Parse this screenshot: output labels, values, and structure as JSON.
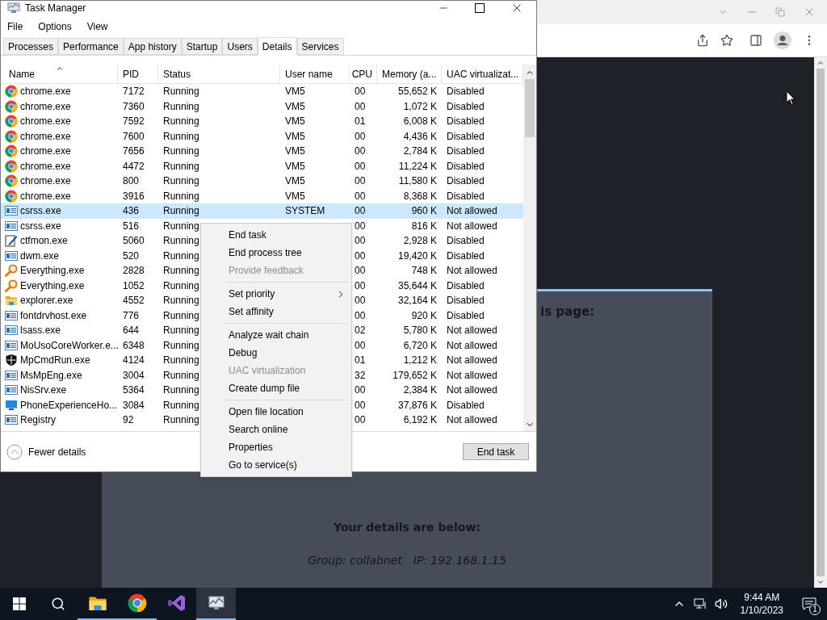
{
  "browser": {
    "page": {
      "heading_fragment": "is page:",
      "details_title": "Your details are below:",
      "group": "Group: collabnet",
      "ip": "IP: 192.168.1.15"
    }
  },
  "task_manager": {
    "title": "Task Manager",
    "menu": [
      "File",
      "Options",
      "View"
    ],
    "tabs": [
      {
        "label": "Processes",
        "selected": false
      },
      {
        "label": "Performance",
        "selected": false
      },
      {
        "label": "App history",
        "selected": false
      },
      {
        "label": "Startup",
        "selected": false
      },
      {
        "label": "Users",
        "selected": false
      },
      {
        "label": "Details",
        "selected": true
      },
      {
        "label": "Services",
        "selected": false
      }
    ],
    "columns": [
      "Name",
      "PID",
      "Status",
      "User name",
      "CPU",
      "Memory (a...",
      "UAC virtualizat..."
    ],
    "rows": [
      {
        "kind": "chrome",
        "name": "chrome.exe",
        "pid": "7172",
        "status": "Running",
        "user": "VM5",
        "cpu": "00",
        "memory": "55,652 K",
        "uac": "Disabled",
        "selected": false
      },
      {
        "kind": "chrome",
        "name": "chrome.exe",
        "pid": "7360",
        "status": "Running",
        "user": "VM5",
        "cpu": "00",
        "memory": "1,072 K",
        "uac": "Disabled",
        "selected": false
      },
      {
        "kind": "chrome",
        "name": "chrome.exe",
        "pid": "7592",
        "status": "Running",
        "user": "VM5",
        "cpu": "01",
        "memory": "6,008 K",
        "uac": "Disabled",
        "selected": false
      },
      {
        "kind": "chrome",
        "name": "chrome.exe",
        "pid": "7600",
        "status": "Running",
        "user": "VM5",
        "cpu": "00",
        "memory": "4,436 K",
        "uac": "Disabled",
        "selected": false
      },
      {
        "kind": "chrome",
        "name": "chrome.exe",
        "pid": "7656",
        "status": "Running",
        "user": "VM5",
        "cpu": "00",
        "memory": "2,784 K",
        "uac": "Disabled",
        "selected": false
      },
      {
        "kind": "chrome",
        "name": "chrome.exe",
        "pid": "4472",
        "status": "Running",
        "user": "VM5",
        "cpu": "00",
        "memory": "11,224 K",
        "uac": "Disabled",
        "selected": false
      },
      {
        "kind": "chrome",
        "name": "chrome.exe",
        "pid": "800",
        "status": "Running",
        "user": "VM5",
        "cpu": "00",
        "memory": "11,580 K",
        "uac": "Disabled",
        "selected": false
      },
      {
        "kind": "chrome",
        "name": "chrome.exe",
        "pid": "3916",
        "status": "Running",
        "user": "VM5",
        "cpu": "00",
        "memory": "8,368 K",
        "uac": "Disabled",
        "selected": false
      },
      {
        "kind": "app",
        "name": "csrss.exe",
        "pid": "436",
        "status": "Running",
        "user": "SYSTEM",
        "cpu": "00",
        "memory": "960 K",
        "uac": "Not allowed",
        "selected": true
      },
      {
        "kind": "app",
        "name": "csrss.exe",
        "pid": "516",
        "status": "Running",
        "cpu": "00",
        "memory": "816 K",
        "uac": "Not allowed",
        "selected": false
      },
      {
        "kind": "editor",
        "name": "ctfmon.exe",
        "pid": "5060",
        "status": "Running",
        "cpu": "00",
        "memory": "2,928 K",
        "uac": "Disabled",
        "selected": false
      },
      {
        "kind": "app",
        "name": "dwm.exe",
        "pid": "520",
        "status": "Running",
        "cpu": "00",
        "memory": "19,420 K",
        "uac": "Disabled",
        "selected": false
      },
      {
        "kind": "search",
        "name": "Everything.exe",
        "pid": "2828",
        "status": "Running",
        "cpu": "00",
        "memory": "748 K",
        "uac": "Not allowed",
        "selected": false
      },
      {
        "kind": "search",
        "name": "Everything.exe",
        "pid": "1052",
        "status": "Running",
        "cpu": "00",
        "memory": "35,644 K",
        "uac": "Disabled",
        "selected": false
      },
      {
        "kind": "folder",
        "name": "explorer.exe",
        "pid": "4552",
        "status": "Running",
        "cpu": "00",
        "memory": "32,164 K",
        "uac": "Disabled",
        "selected": false
      },
      {
        "kind": "app",
        "name": "fontdrvhost.exe",
        "pid": "776",
        "status": "Running",
        "cpu": "00",
        "memory": "920 K",
        "uac": "Disabled",
        "selected": false
      },
      {
        "kind": "app",
        "name": "lsass.exe",
        "pid": "644",
        "status": "Running",
        "cpu": "02",
        "memory": "5,780 K",
        "uac": "Not allowed",
        "selected": false
      },
      {
        "kind": "app",
        "name": "MoUsoCoreWorker.e...",
        "pid": "6348",
        "status": "Running",
        "cpu": "00",
        "memory": "6,720 K",
        "uac": "Not allowed",
        "selected": false
      },
      {
        "kind": "shield",
        "name": "MpCmdRun.exe",
        "pid": "4124",
        "status": "Running",
        "cpu": "01",
        "memory": "1,212 K",
        "uac": "Not allowed",
        "selected": false
      },
      {
        "kind": "app",
        "name": "MsMpEng.exe",
        "pid": "3004",
        "status": "Running",
        "cpu": "32",
        "memory": "179,652 K",
        "uac": "Not allowed",
        "selected": false
      },
      {
        "kind": "app",
        "name": "NisSrv.exe",
        "pid": "5364",
        "status": "Running",
        "cpu": "00",
        "memory": "2,384 K",
        "uac": "Not allowed",
        "selected": false
      },
      {
        "kind": "monitor",
        "name": "PhoneExperienceHo...",
        "pid": "3084",
        "status": "Running",
        "cpu": "00",
        "memory": "37,876 K",
        "uac": "Disabled",
        "selected": false
      },
      {
        "kind": "app",
        "name": "Registry",
        "pid": "92",
        "status": "Running",
        "cpu": "00",
        "memory": "6,192 K",
        "uac": "Not allowed",
        "selected": false
      }
    ],
    "fewer_details": "Fewer details",
    "end_task": "End task"
  },
  "context_menu": [
    [
      {
        "label": "End task",
        "disabled": false,
        "submenu": false
      },
      {
        "label": "End process tree",
        "disabled": false,
        "submenu": false
      },
      {
        "label": "Provide feedback",
        "disabled": true,
        "submenu": false
      }
    ],
    [
      {
        "label": "Set priority",
        "disabled": false,
        "submenu": true
      },
      {
        "label": "Set affinity",
        "disabled": false,
        "submenu": false
      }
    ],
    [
      {
        "label": "Analyze wait chain",
        "disabled": false,
        "submenu": false
      },
      {
        "label": "Debug",
        "disabled": false,
        "submenu": false
      },
      {
        "label": "UAC virtualization",
        "disabled": true,
        "submenu": false
      },
      {
        "label": "Create dump file",
        "disabled": false,
        "submenu": false
      }
    ],
    [
      {
        "label": "Open file location",
        "disabled": false,
        "submenu": false
      },
      {
        "label": "Search online",
        "disabled": false,
        "submenu": false
      },
      {
        "label": "Properties",
        "disabled": false,
        "submenu": false
      },
      {
        "label": "Go to service(s)",
        "disabled": false,
        "submenu": false
      }
    ]
  ],
  "taskbar": {
    "apps": [
      {
        "kind": "folder",
        "running": true,
        "selected": false
      },
      {
        "kind": "chrome",
        "running": true,
        "selected": false
      },
      {
        "kind": "studio",
        "running": false,
        "selected": false
      },
      {
        "kind": "taskmanager",
        "running": true,
        "selected": true
      }
    ],
    "time": "9:44 AM",
    "date": "1/10/2023",
    "notifications": "1"
  }
}
